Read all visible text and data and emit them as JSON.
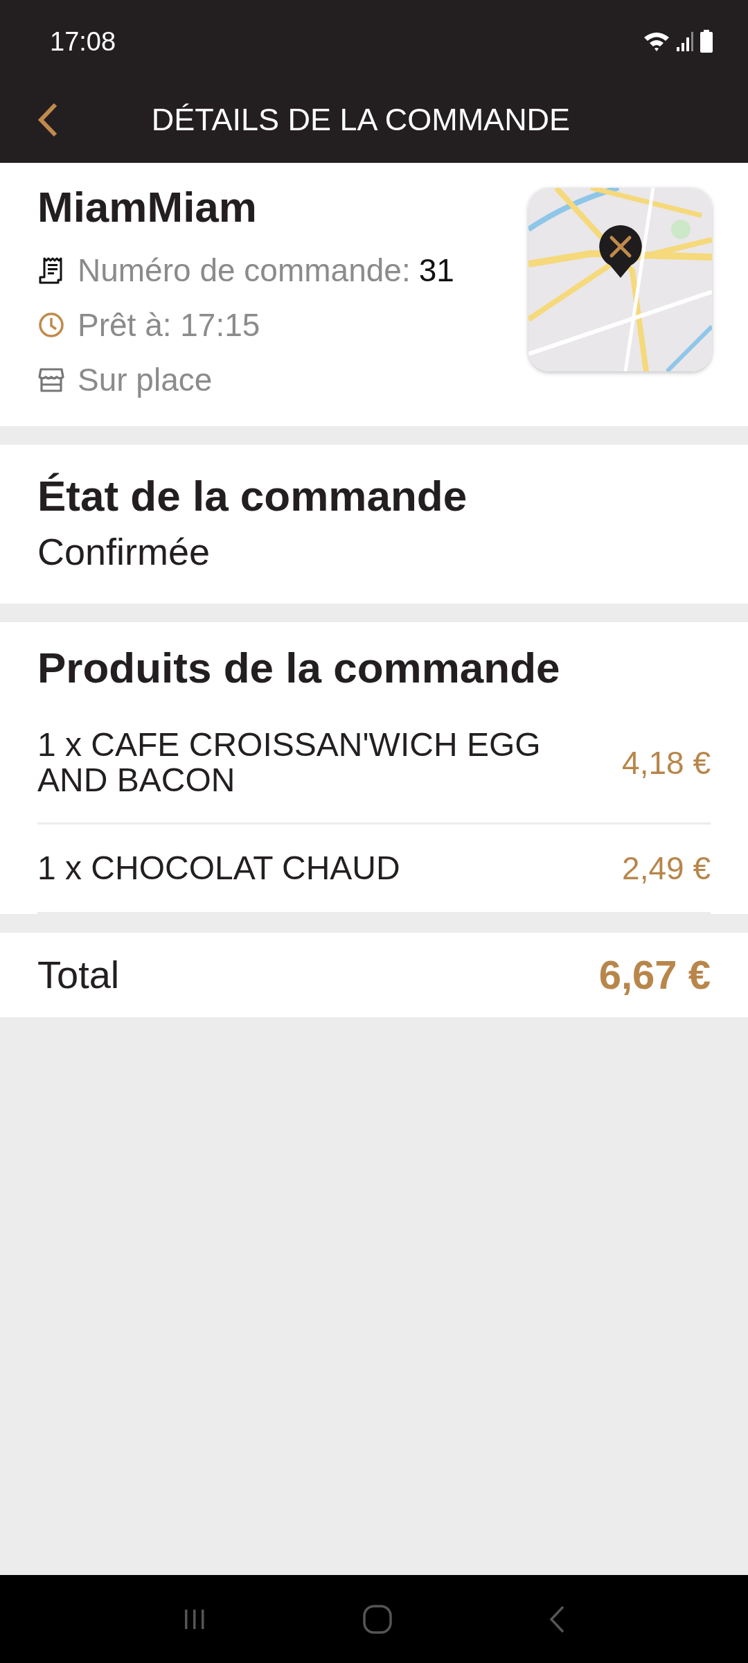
{
  "status_bar": {
    "time": "17:08"
  },
  "app_bar": {
    "title": "DÉTAILS DE LA COMMANDE"
  },
  "restaurant": {
    "name": "MiamMiam",
    "details": [
      {
        "kind": "order-number",
        "label": "Numéro de commande:",
        "value": "31"
      },
      {
        "kind": "ready-time",
        "label": "Prêt à: 17:15"
      },
      {
        "kind": "service",
        "label": "Sur place"
      }
    ]
  },
  "order_status": {
    "heading": "État de la commande",
    "value": "Confirmée"
  },
  "products": {
    "heading": "Produits de la commande",
    "items": [
      {
        "name": "1 x CAFE CROISSAN'WICH EGG AND BACON",
        "price": "4,18 €"
      },
      {
        "name": "1 x CHOCOLAT CHAUD",
        "price": "2,49 €"
      }
    ]
  },
  "total": {
    "label": "Total",
    "value": "6,67 €"
  }
}
